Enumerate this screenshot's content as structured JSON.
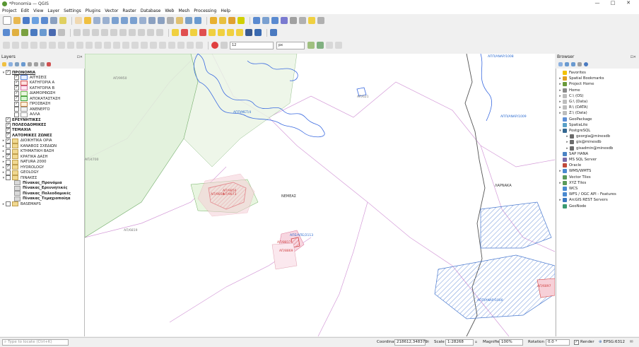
{
  "window": {
    "title": "*Pronomia — QGIS",
    "controls": [
      "—",
      "□",
      "✕"
    ]
  },
  "menu": [
    "Project",
    "Edit",
    "View",
    "Layer",
    "Settings",
    "Plugins",
    "Vector",
    "Raster",
    "Database",
    "Web",
    "Mesh",
    "Processing",
    "Help"
  ],
  "toolbar": {
    "scale_combo_value": "12",
    "unit_combo_value": "px"
  },
  "layers_panel": {
    "title": "Layers",
    "items": [
      {
        "label": "ΠΡΟΝΟΜΙΑ",
        "checked": true,
        "expanded": true,
        "bold": true,
        "underline": true,
        "level": 0
      },
      {
        "label": "ΑΙΤΗΣΕΙΣ",
        "checked": true,
        "level": 1,
        "swatch": "#e8f0ff",
        "swatch_border": "#5a7fd0"
      },
      {
        "label": "ΚΑΤΗΓΟΡΙΑ Α",
        "checked": true,
        "level": 1,
        "swatch": "#ffe0e0",
        "swatch_border": "#d05050"
      },
      {
        "label": "ΚΑΤΗΓΟΡΙΑ Β",
        "checked": true,
        "level": 1,
        "swatch": "#fde6f0",
        "swatch_border": "#d070a0"
      },
      {
        "label": "ΔΙΑΜΟΡΦΩΣΗ",
        "checked": true,
        "level": 1,
        "swatch": "#e9f7e0",
        "swatch_border": "#70b050"
      },
      {
        "label": "ΑΠΟΚΑΤΑΣΤΑΣΗ",
        "checked": true,
        "level": 1,
        "swatch": "#d8f5d0",
        "swatch_border": "#40a040"
      },
      {
        "label": "ΠΡΟΣΒΑΣΗ",
        "checked": true,
        "level": 1,
        "swatch": "#fff0dd",
        "swatch_border": "#c08040"
      },
      {
        "label": "ΑΝΕΝΕΡΓΟ",
        "checked": false,
        "level": 1,
        "swatch": "#f2f2f2",
        "swatch_border": "#999999"
      },
      {
        "label": "ΑΛΛΑ",
        "checked": false,
        "level": 1,
        "swatch": "#ffffff",
        "swatch_border": "#999999"
      },
      {
        "label": "ΕΡΕΥΝΗΤΙΚΕΣ",
        "checked": true,
        "level": 0,
        "bold": true
      },
      {
        "label": "ΠΟΛΕΟΔΟΜΙΚΕΣ",
        "checked": true,
        "level": 0,
        "bold": true
      },
      {
        "label": "ΤΕΜΑΧΙΑ",
        "checked": true,
        "level": 0,
        "bold": true
      },
      {
        "label": "ΛΑΤΟΜΙΚΕΣ ΖΩΝΕΣ",
        "checked": true,
        "level": 0,
        "bold": true
      },
      {
        "label": "ΔΙΟΙΚΗΤΙΚΑ ΟΡΙΑ",
        "checked": true,
        "expand": "▸",
        "group": true,
        "level": 0
      },
      {
        "label": "ΚΑΝΑΒΟΣ ΣΧΕΔΙΩΝ",
        "checked": false,
        "expand": "▸",
        "group": true,
        "level": 0
      },
      {
        "label": "ΚΤΗΜΑΤΙΚΗ ΒΑΣΗ",
        "checked": false,
        "expand": "▸",
        "group": true,
        "level": 0
      },
      {
        "label": "ΚΡΑΤΙΚΑ ΔΑΣΗ",
        "checked": true,
        "expand": "▸",
        "group": true,
        "level": 0
      },
      {
        "label": "NATURA 2000",
        "checked": false,
        "expand": "▸",
        "group": true,
        "level": 0
      },
      {
        "label": "HYDROLOGY",
        "checked": true,
        "expand": "▸",
        "group": true,
        "level": 0
      },
      {
        "label": "GEOLOGY",
        "checked": false,
        "expand": "▸",
        "group": true,
        "level": 0
      },
      {
        "label": "ΠΙΝΑΚΕΣ",
        "checked": false,
        "expand": "▾",
        "group": true,
        "level": 0
      },
      {
        "label": "Πίνακας_Προνόμια",
        "table": true,
        "bold": true,
        "level": 1
      },
      {
        "label": "Πίνακας_Ερευνητικές",
        "table": true,
        "bold": true,
        "level": 1
      },
      {
        "label": "Πίνακας_Πολεοδομικές",
        "table": true,
        "bold": true,
        "level": 1
      },
      {
        "label": "Πίνακας_Τεμαχιοποίηα",
        "table": true,
        "bold": true,
        "level": 1
      },
      {
        "label": "BASEMAPS",
        "checked": false,
        "expand": "▸",
        "group": true,
        "level": 0
      }
    ]
  },
  "browser_panel": {
    "title": "Browser",
    "items": [
      {
        "label": "Favorites",
        "icon": "star-icon",
        "color": "#f2c200",
        "level": 0
      },
      {
        "label": "Spatial Bookmarks",
        "icon": "bookmark-icon",
        "color": "#e0a020",
        "expand": "▸",
        "level": 0
      },
      {
        "label": "Project Home",
        "icon": "folder-icon",
        "color": "#6a9a3a",
        "expand": "▸",
        "level": 0
      },
      {
        "label": "Home",
        "icon": "home-icon",
        "color": "#8a8a8a",
        "expand": "▸",
        "level": 0
      },
      {
        "label": "C:\\ (OS)",
        "icon": "drive-icon",
        "color": "#bdbdbd",
        "expand": "▸",
        "level": 0
      },
      {
        "label": "G:\\ (Data)",
        "icon": "drive-icon",
        "color": "#bdbdbd",
        "expand": "▸",
        "level": 0
      },
      {
        "label": "R:\\ (DATA)",
        "icon": "drive-icon",
        "color": "#bdbdbd",
        "expand": "▸",
        "level": 0
      },
      {
        "label": "Z:\\ (Data)",
        "icon": "drive-icon",
        "color": "#bdbdbd",
        "expand": "▸",
        "level": 0
      },
      {
        "label": "GeoPackage",
        "icon": "geopackage-icon",
        "color": "#5c8ed6",
        "level": 0
      },
      {
        "label": "SpatiaLite",
        "icon": "spatialite-icon",
        "color": "#5aa0c8",
        "level": 0
      },
      {
        "label": "PostgreSQL",
        "icon": "postgresql-icon",
        "color": "#336791",
        "expand": "▾",
        "level": 0
      },
      {
        "label": "georgia@minesdb",
        "icon": "connection-icon",
        "color": "#6b6b6b",
        "expand": "▸",
        "level": 1
      },
      {
        "label": "gis@minesdb",
        "icon": "connection-icon",
        "color": "#6b6b6b",
        "expand": "▸",
        "level": 1
      },
      {
        "label": "gisadmin@minesdb",
        "icon": "connection-icon",
        "color": "#6b6b6b",
        "expand": "▸",
        "level": 1
      },
      {
        "label": "SAP HANA",
        "icon": "sap-hana-icon",
        "color": "#4a84c4",
        "level": 0
      },
      {
        "label": "MS SQL Server",
        "icon": "mssql-icon",
        "color": "#7a6aa8",
        "level": 0
      },
      {
        "label": "Oracle",
        "icon": "oracle-icon",
        "color": "#c04a3a",
        "level": 0
      },
      {
        "label": "WMS/WMTS",
        "icon": "wms-icon",
        "color": "#4a8ad0",
        "expand": "▸",
        "level": 0
      },
      {
        "label": "Vector Tiles",
        "icon": "vector-tiles-icon",
        "color": "#5a9a5a",
        "level": 0
      },
      {
        "label": "XYZ Tiles",
        "icon": "xyz-tiles-icon",
        "color": "#5a9a5a",
        "expand": "▸",
        "level": 0
      },
      {
        "label": "WCS",
        "icon": "wcs-icon",
        "color": "#4a8ad0",
        "level": 0
      },
      {
        "label": "WFS / OGC API - Features",
        "icon": "wfs-icon",
        "color": "#4a8ad0",
        "level": 0
      },
      {
        "label": "ArcGIS REST Servers",
        "icon": "arcgis-icon",
        "color": "#3a78c0",
        "expand": "▸",
        "level": 0
      },
      {
        "label": "GeoNode",
        "icon": "geonode-icon",
        "color": "#3a9a70",
        "level": 0
      }
    ]
  },
  "map": {
    "labels": [
      {
        "text": "ΝΕΜΕΑΣ",
        "color": "#333333"
      },
      {
        "text": "ΛΑΡΝΑΚΑ",
        "color": "#333333"
      },
      {
        "text": "ΑΠΠ/ΑΝΑΡ/1008",
        "color": "#2a6ad0"
      },
      {
        "text": "ΑΠΠ/ΑΝΑΡ/1009",
        "color": "#2a6ad0"
      },
      {
        "text": "ΑΠΠ/ΑΝΑΡ/1000",
        "color": "#2a6ad0"
      },
      {
        "text": "ΑΠΠ/ΜΕΤ/4",
        "color": "#2a6ad0"
      },
      {
        "text": "ΑΠΕ/ΑΠΕ/2113",
        "color": "#2a6ad0"
      },
      {
        "text": "ΑΠ/621",
        "color": "#777777"
      },
      {
        "text": "ΑΠ/9950",
        "color": "#777777"
      },
      {
        "text": "ΑΠ/4700",
        "color": "#777777"
      },
      {
        "text": "ΑΠ/6819",
        "color": "#777777"
      },
      {
        "text": "ΑΠ/9856",
        "color": "#d04040"
      },
      {
        "text": "ΑΠ/9856",
        "color": "#d04040"
      },
      {
        "text": "ΑΠ/9873",
        "color": "#d04040"
      },
      {
        "text": "ΑΠ/8817",
        "color": "#d04040"
      },
      {
        "text": "ΑΠ/8869",
        "color": "#d04040"
      },
      {
        "text": "ΑΠ/6897",
        "color": "#d04040"
      }
    ]
  },
  "status": {
    "locator_placeholder": "Type to locate (Ctrl+K)",
    "coordinate_label": "Coordinate",
    "coordinate": "218612,348379",
    "scale_label": "Scale",
    "scale": "1:28268",
    "magnifier_label": "Magnifier",
    "magnifier": "100%",
    "rotation_label": "Rotation",
    "rotation": "0.0 °",
    "render_label": "Render",
    "crs": "EPSG:6312"
  }
}
